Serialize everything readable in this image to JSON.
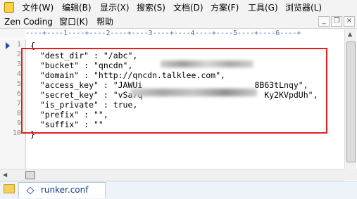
{
  "menus_row1": [
    {
      "label": "文件(W)"
    },
    {
      "label": "编辑(B)"
    },
    {
      "label": "显示(X)"
    },
    {
      "label": "搜索(S)"
    },
    {
      "label": "文档(D)"
    },
    {
      "label": "方案(F)"
    },
    {
      "label": "工具(G)"
    },
    {
      "label": "浏览器(L)"
    }
  ],
  "menus_row2": [
    {
      "label": "Zen Coding"
    },
    {
      "label": "窗口(K)"
    },
    {
      "label": "帮助"
    }
  ],
  "window_buttons": {
    "minimize": "_",
    "restore": "❐",
    "close": "×"
  },
  "ruler": "----+----1----+----2----+----3----+----4----+----5----+----6----+",
  "line_numbers": [
    "1",
    "2",
    "3",
    "4",
    "5",
    "6",
    "7",
    "8",
    "9",
    "10"
  ],
  "code_lines": [
    "{",
    "  \"dest_dir\" : \"/abc\",",
    "  \"bucket\" : \"qncdn\",",
    "  \"domain\" : \"http://qncdn.talklee.com\",",
    "  \"access_key\" : \"JAWUi                       8B63tLnqy\",",
    "  \"secret_key\" : \"vSa7q                         Ky2KVpdUh\",",
    "  \"is_private\" : true,",
    "  \"prefix\" : \"\",",
    "  \"suffix\" : \"\"",
    "}"
  ],
  "tab": {
    "label": "runker.conf"
  },
  "colors": {
    "highlight_border": "#e02020",
    "line_marker": "#1e4ca8",
    "tab_text": "#103a8a"
  }
}
